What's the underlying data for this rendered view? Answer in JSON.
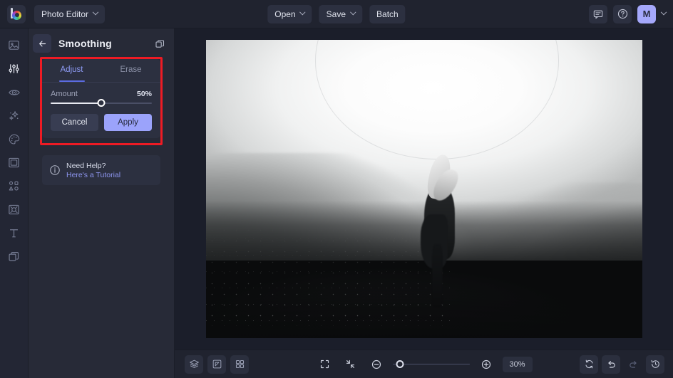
{
  "topbar": {
    "logo_name": "befunky-logo",
    "app_switcher": {
      "label": "Photo Editor",
      "icon": "chevron-down-icon"
    },
    "center_buttons": [
      {
        "label": "Open",
        "has_chevron": true,
        "name": "open-button"
      },
      {
        "label": "Save",
        "has_chevron": true,
        "name": "save-button"
      },
      {
        "label": "Batch",
        "has_chevron": false,
        "name": "batch-button"
      }
    ],
    "right": {
      "feedback_icon": "chat-bubble-icon",
      "help_icon": "question-circle-icon",
      "avatar_initial": "M",
      "avatar_chevron": "chevron-down-icon"
    }
  },
  "rail": {
    "items": [
      {
        "name": "sidebar-item-image",
        "icon": "image-icon",
        "active": false
      },
      {
        "name": "sidebar-item-edit",
        "icon": "sliders-icon",
        "active": true
      },
      {
        "name": "sidebar-item-touchup",
        "icon": "eye-icon",
        "active": false
      },
      {
        "name": "sidebar-item-effects",
        "icon": "sparkles-icon",
        "active": false
      },
      {
        "name": "sidebar-item-artsy",
        "icon": "palette-icon",
        "active": false
      },
      {
        "name": "sidebar-item-frames",
        "icon": "frame-icon",
        "active": false
      },
      {
        "name": "sidebar-item-graphics",
        "icon": "shapes-icon",
        "active": false
      },
      {
        "name": "sidebar-item-textures",
        "icon": "texture-icon",
        "active": false
      },
      {
        "name": "sidebar-item-text",
        "icon": "text-t-icon",
        "active": false
      },
      {
        "name": "sidebar-item-layers",
        "icon": "layers-copy-icon",
        "active": false
      }
    ]
  },
  "panel": {
    "back_icon": "arrow-left-icon",
    "title": "Smoothing",
    "head_icon": "duplicate-icon",
    "tabs": [
      {
        "label": "Adjust",
        "active": true
      },
      {
        "label": "Erase",
        "active": false
      }
    ],
    "slider": {
      "label": "Amount",
      "value_text": "50%",
      "percent": 50
    },
    "buttons": {
      "cancel": "Cancel",
      "apply": "Apply"
    },
    "help": {
      "icon": "info-circle-icon",
      "title": "Need Help?",
      "link": "Here's a Tutorial"
    },
    "highlight_color": "#ee1b24"
  },
  "canvas": {
    "image_name": "foggy-landscape-photo",
    "image_alt": "Black and white photo of a person standing in a foggy field with hills"
  },
  "bottombar": {
    "left_icons": [
      {
        "name": "layers-icon",
        "icon": "layers-stack-icon"
      },
      {
        "name": "transform-icon",
        "icon": "resize-arrow-icon"
      },
      {
        "name": "grid-icon",
        "icon": "four-squares-icon"
      }
    ],
    "center": {
      "fit_screen_icon": "expand-frame-icon",
      "actual_size_icon": "collapse-arrows-icon",
      "zoom_out_icon": "minus-circle-icon",
      "zoom_in_icon": "plus-circle-icon",
      "zoom_percent": 10,
      "zoom_label": "30%"
    },
    "right_icons": [
      {
        "name": "reset-icon",
        "icon": "refresh-icon",
        "dim": false
      },
      {
        "name": "undo-icon",
        "icon": "undo-arrow-icon",
        "dim": false
      },
      {
        "name": "redo-icon",
        "icon": "redo-arrow-icon",
        "dim": true
      },
      {
        "name": "history-icon",
        "icon": "clock-rewind-icon",
        "dim": false
      }
    ]
  },
  "colors": {
    "accent": "#9ba3fb",
    "tab_active": "#8e9bf5",
    "highlight": "#ee1b24",
    "panel_bg": "#272a37",
    "card_bg": "#2c3040"
  }
}
